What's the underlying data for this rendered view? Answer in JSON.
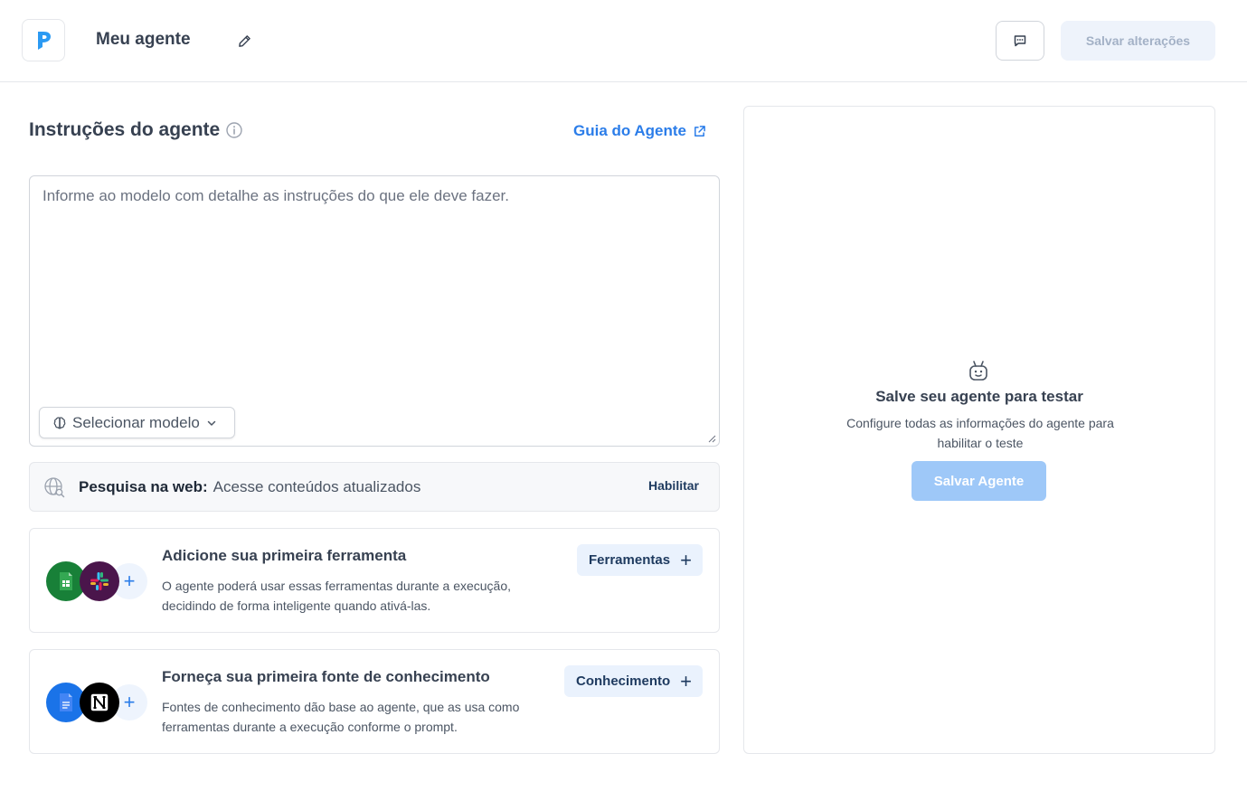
{
  "header": {
    "agent_name": "Meu agente",
    "save_changes_label": "Salvar alterações",
    "logo_letter": "P",
    "brand_color": "#2b9af3"
  },
  "instructions": {
    "title": "Instruções do agente",
    "guide_link": "Guia do Agente",
    "placeholder": "Informe ao modelo com detalhe as instruções do que ele deve fazer.",
    "model_select_label": "Selecionar modelo"
  },
  "web_search": {
    "label": "Pesquisa na web:",
    "description": "Acesse conteúdos atualizados",
    "enable_label": "Habilitar"
  },
  "tools_card": {
    "title": "Adicione sua primeira ferramenta",
    "description": "O agente poderá usar essas ferramentas durante a execução, decidindo de forma inteligente quando ativá-las.",
    "button_label": "Ferramentas",
    "icons": [
      "google-sheets-icon",
      "slack-icon",
      "plus-icon"
    ]
  },
  "knowledge_card": {
    "title": "Forneça sua primeira fonte de conhecimento",
    "description": "Fontes de conhecimento dão base ao agente, que as usa como ferramentas durante a execução conforme o prompt.",
    "button_label": "Conhecimento",
    "icons": [
      "google-docs-icon",
      "notion-icon",
      "plus-icon"
    ]
  },
  "test_panel": {
    "title": "Salve seu agente para testar",
    "description": "Configure todas as informações do agente para habilitar o teste",
    "button_label": "Salvar Agente"
  },
  "colors": {
    "accent": "#2b7de9",
    "disabled_button": "#9ec8f8",
    "sheets_green": "#188038",
    "slack_purple": "#4a154b",
    "docs_blue": "#1a73e8"
  }
}
